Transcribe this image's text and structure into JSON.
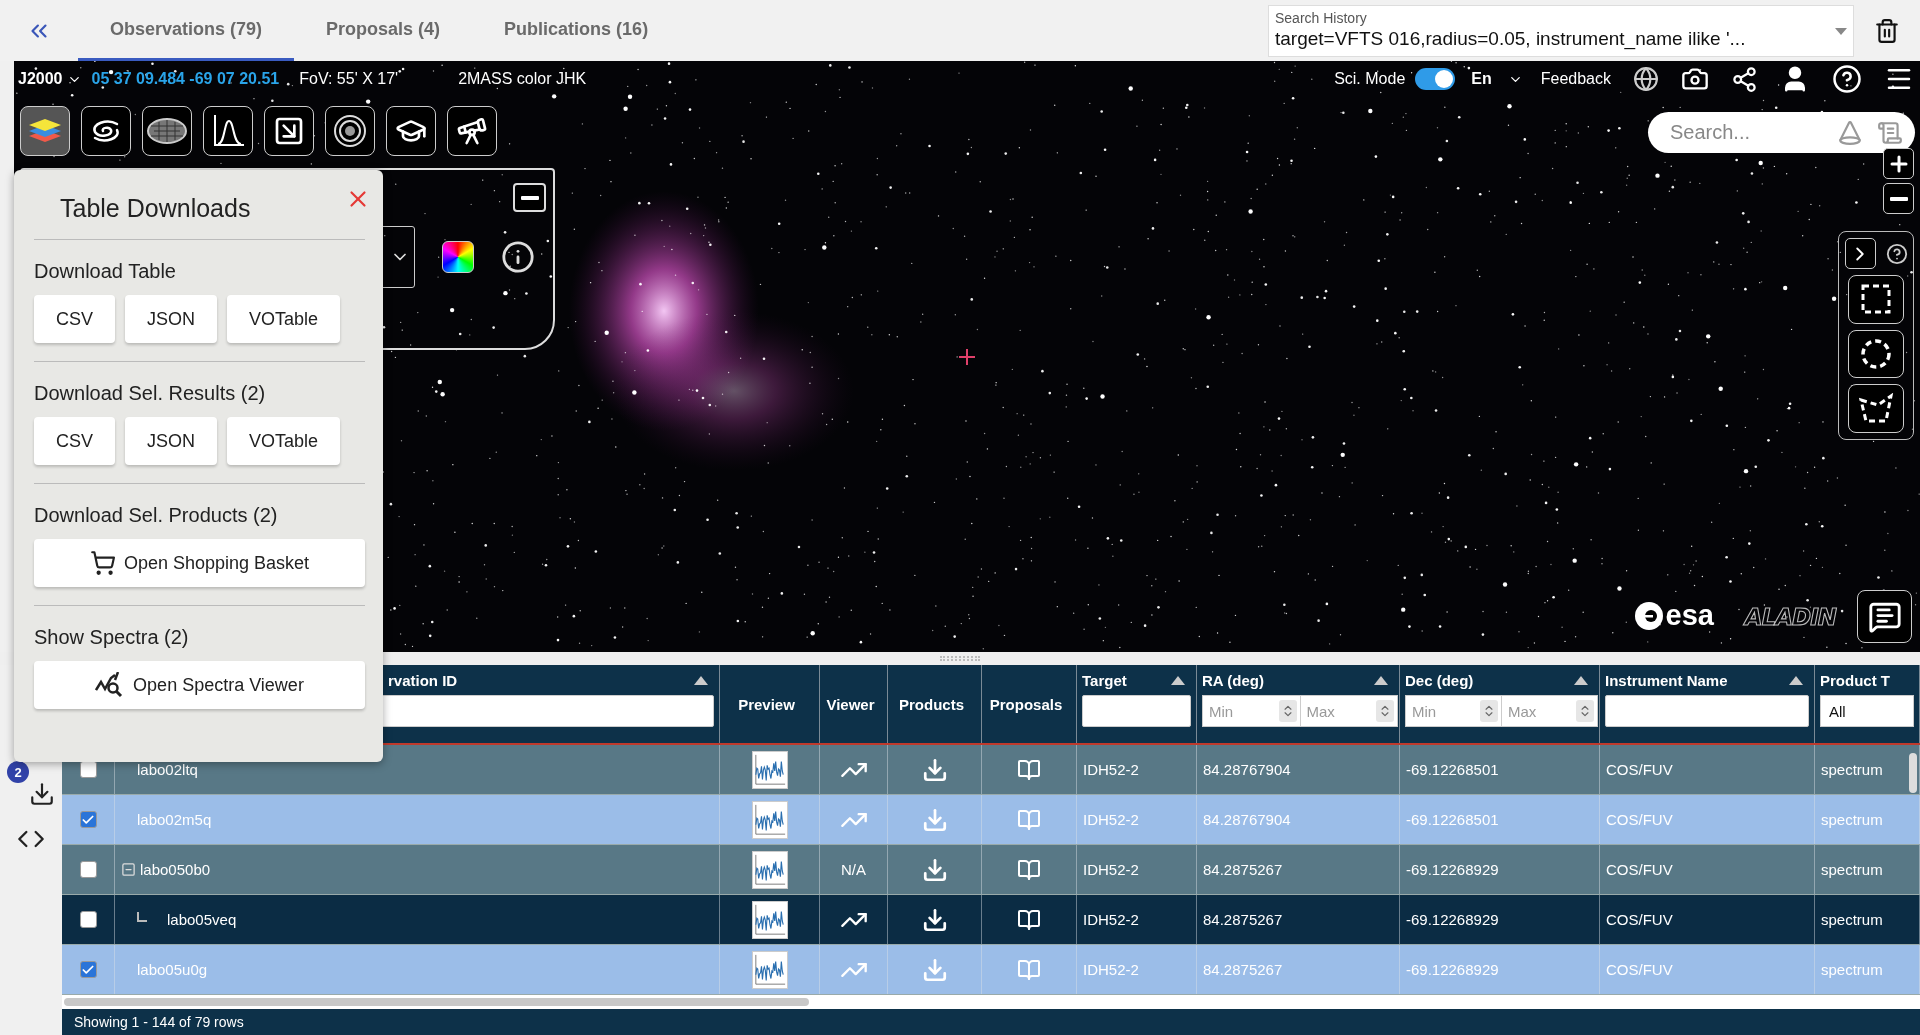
{
  "tabs": [
    {
      "label": "Observations (79)",
      "selected": true
    },
    {
      "label": "Proposals (4)",
      "selected": false
    },
    {
      "label": "Publications (16)",
      "selected": false
    }
  ],
  "search_history": {
    "label": "Search History",
    "value": "target=VFTS 016,radius=0.05, instrument_name ilike '..."
  },
  "sky_view": {
    "frame": "J2000",
    "coordinates": "05 37 09.484 -69 07 20.51",
    "fov": "FoV: 55' X 17'",
    "survey": "2MASS color JHK",
    "sci_mode": {
      "label": "Sci. Mode",
      "on": true
    },
    "language": "En",
    "feedback": "Feedback",
    "search": {
      "placeholder": "Search..."
    },
    "toolbar": [
      {
        "selected": true
      },
      {
        "selected": false
      },
      {
        "selected": false
      },
      {
        "selected": false
      },
      {
        "selected": false
      },
      {
        "selected": false
      },
      {
        "selected": false
      },
      {
        "selected": false
      }
    ],
    "logos": {
      "esa": "esa",
      "aladin": "ALADIN"
    }
  },
  "download_panel": {
    "title": "Table Downloads",
    "sections": [
      {
        "heading": "Download Table",
        "kind": "formats",
        "buttons": [
          "CSV",
          "JSON",
          "VOTable"
        ]
      },
      {
        "heading": "Download Sel. Results (2)",
        "kind": "formats",
        "buttons": [
          "CSV",
          "JSON",
          "VOTable"
        ]
      },
      {
        "heading": "Download Sel. Products (2)",
        "kind": "basket",
        "buttons": [
          "Open Shopping Basket"
        ]
      },
      {
        "heading": "Show Spectra (2)",
        "kind": "spectra",
        "buttons": [
          "Open Spectra Viewer"
        ]
      }
    ]
  },
  "side_rail": {
    "badge": "2"
  },
  "table": {
    "columns": [
      {
        "label": "rvation ID",
        "sort_arrow": true,
        "filter": {
          "kind": "text"
        }
      },
      {
        "label": "Preview",
        "sort_arrow": false,
        "filter": {
          "kind": "none"
        }
      },
      {
        "label": "Viewer",
        "sort_arrow": false,
        "filter": {
          "kind": "none"
        }
      },
      {
        "label": "Products",
        "sort_arrow": false,
        "filter": {
          "kind": "none"
        }
      },
      {
        "label": "Proposals",
        "sort_arrow": false,
        "filter": {
          "kind": "none"
        }
      },
      {
        "label": "Target",
        "sort_arrow": true,
        "filter": {
          "kind": "text"
        }
      },
      {
        "label": "RA (deg)",
        "sort_arrow": true,
        "filter": {
          "kind": "range",
          "min_placeholder": "Min",
          "max_placeholder": "Max"
        }
      },
      {
        "label": "Dec (deg)",
        "sort_arrow": true,
        "filter": {
          "kind": "range",
          "min_placeholder": "Min",
          "max_placeholder": "Max"
        }
      },
      {
        "label": "Instrument Name",
        "sort_arrow": true,
        "filter": {
          "kind": "text"
        }
      },
      {
        "label": "Product T",
        "sort_arrow": false,
        "filter": {
          "kind": "select",
          "value": "All"
        }
      }
    ],
    "rows": [
      {
        "id": "labo02ltq",
        "checked": false,
        "target": "IDH52-2",
        "ra": "84.28767904",
        "dec": "-69.12268501",
        "instrument": "COS/FUV",
        "product_type": "spectrum"
      },
      {
        "id": "labo02m5q",
        "checked": true,
        "target": "IDH52-2",
        "ra": "84.28767904",
        "dec": "-69.12268501",
        "instrument": "COS/FUV",
        "product_type": "spectrum"
      },
      {
        "id": "labo050b0",
        "checked": false,
        "expanded": true,
        "viewer": "N/A",
        "target": "IDH52-2",
        "ra": "84.2875267",
        "dec": "-69.12268929",
        "instrument": "COS/FUV",
        "product_type": "spectrum",
        "children": [
          {
            "id": "labo05veq",
            "checked": false,
            "target": "IDH52-2",
            "ra": "84.2875267",
            "dec": "-69.12268929",
            "instrument": "COS/FUV",
            "product_type": "spectrum"
          }
        ]
      },
      {
        "id": "labo05u0g",
        "checked": true,
        "target": "IDH52-2",
        "ra": "84.2875267",
        "dec": "-69.12268929",
        "instrument": "COS/FUV",
        "product_type": "spectrum"
      }
    ],
    "footer": "Showing 1 - 144 of 79 rows"
  }
}
